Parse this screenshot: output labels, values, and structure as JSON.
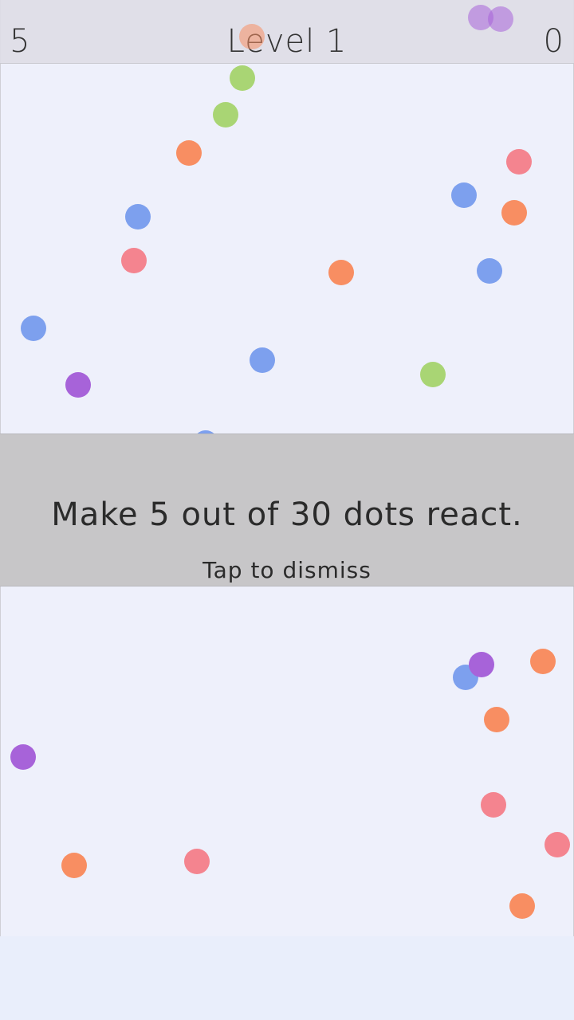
{
  "hud": {
    "left_value": "5",
    "level_label": "Level 1",
    "score": "0"
  },
  "overlay": {
    "message": "Make 5 out of 30 dots react.",
    "hint": "Tap to dismiss"
  },
  "colors": {
    "blue": "#7da0ee",
    "green": "#a9d574",
    "orange": "#f88e62",
    "pink": "#f4848f",
    "purple": "#a763d9",
    "playfield_bg": "#eef0fb",
    "overlay_bg": "#c7c6c8"
  }
}
